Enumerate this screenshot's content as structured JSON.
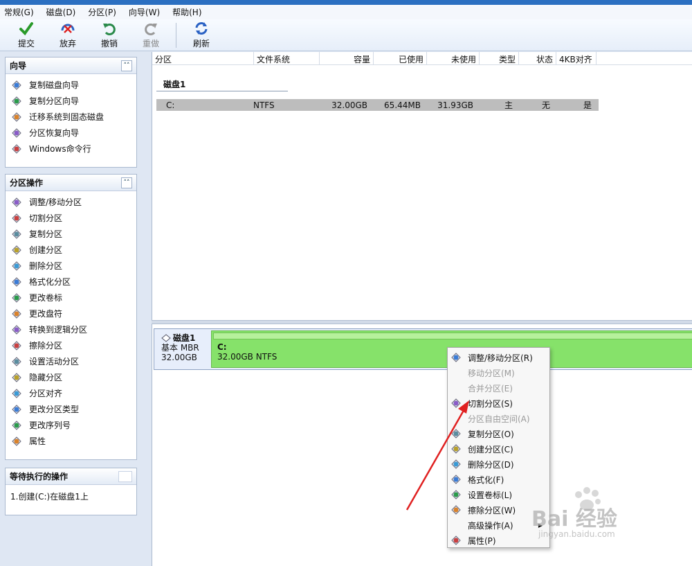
{
  "menubar": {
    "items": [
      "常规(G)",
      "磁盘(D)",
      "分区(P)",
      "向导(W)",
      "帮助(H)"
    ]
  },
  "toolbar": {
    "buttons": [
      {
        "label": "提交",
        "icon": "check-icon",
        "enabled": true
      },
      {
        "label": "放弃",
        "icon": "discard-icon",
        "enabled": true
      },
      {
        "label": "撤销",
        "icon": "undo-icon",
        "enabled": true
      },
      {
        "label": "重做",
        "icon": "redo-icon",
        "enabled": false
      },
      {
        "label": "刷新",
        "icon": "refresh-icon",
        "enabled": true
      }
    ]
  },
  "wizard_panel": {
    "title": "向导",
    "items": [
      "复制磁盘向导",
      "复制分区向导",
      "迁移系统到固态磁盘",
      "分区恢复向导",
      "Windows命令行"
    ]
  },
  "partition_ops_panel": {
    "title": "分区操作",
    "items": [
      "调整/移动分区",
      "切割分区",
      "复制分区",
      "创建分区",
      "删除分区",
      "格式化分区",
      "更改卷标",
      "更改盘符",
      "转换到逻辑分区",
      "擦除分区",
      "设置活动分区",
      "隐藏分区",
      "分区对齐",
      "更改分区类型",
      "更改序列号",
      "属性"
    ]
  },
  "pending_panel": {
    "title": "等待执行的操作",
    "items": [
      "1.创建(C:)在磁盘1上"
    ]
  },
  "table": {
    "columns": [
      "分区",
      "文件系统",
      "容量",
      "已使用",
      "未使用",
      "类型",
      "状态",
      "4KB对齐"
    ],
    "disk_label": "磁盘1",
    "rows": [
      {
        "partition": "C:",
        "fs": "NTFS",
        "capacity": "32.00GB",
        "used": "65.44MB",
        "unused": "31.93GB",
        "type": "主",
        "status": "无",
        "aligned": "是"
      }
    ]
  },
  "disk_map": {
    "disk_name": "磁盘1",
    "disk_type": "基本 MBR",
    "disk_size": "32.00GB",
    "partition_label": "C:",
    "partition_info": "32.00GB NTFS"
  },
  "context_menu": {
    "items": [
      {
        "label": "调整/移动分区(R)",
        "enabled": true,
        "icon": "resize-icon"
      },
      {
        "label": "移动分区(M)",
        "enabled": false,
        "icon": ""
      },
      {
        "label": "合并分区(E)",
        "enabled": false,
        "icon": ""
      },
      {
        "label": "切割分区(S)",
        "enabled": true,
        "icon": "split-icon"
      },
      {
        "label": "分区自由空间(A)",
        "enabled": false,
        "icon": ""
      },
      {
        "label": "复制分区(O)",
        "enabled": true,
        "icon": "copy-icon"
      },
      {
        "label": "创建分区(C)",
        "enabled": true,
        "icon": "create-icon"
      },
      {
        "label": "删除分区(D)",
        "enabled": true,
        "icon": "delete-icon"
      },
      {
        "label": "格式化(F)",
        "enabled": true,
        "icon": "format-icon"
      },
      {
        "label": "设置卷标(L)",
        "enabled": true,
        "icon": "label-icon"
      },
      {
        "label": "擦除分区(W)",
        "enabled": true,
        "icon": "wipe-icon"
      },
      {
        "label": "高级操作(A)",
        "enabled": true,
        "icon": "",
        "submenu": true
      },
      {
        "label": "属性(P)",
        "enabled": true,
        "icon": "info-icon"
      }
    ]
  },
  "watermark": {
    "main": "Bai 经验",
    "sub": "jingyan.baidu.com"
  },
  "colors": {
    "partition_fill": "#86e26a",
    "selected_row": "#bdbdbd",
    "annotation_arrow": "#e02020"
  }
}
